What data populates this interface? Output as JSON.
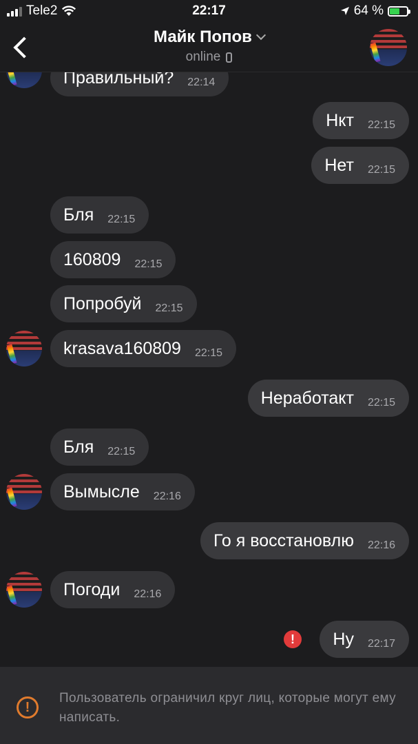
{
  "status_bar": {
    "carrier": "Tele2",
    "time": "22:17",
    "battery": "64 %",
    "battery_level": 0.64,
    "icons": [
      "signal-icon",
      "wifi-icon",
      "location-arrow-icon",
      "battery-icon"
    ]
  },
  "header": {
    "contact_name": "Майк Попов",
    "status": "online"
  },
  "messages": [
    {
      "direction": "in",
      "text": "Правильный?",
      "time": "22:14",
      "avatar": true
    },
    {
      "direction": "out",
      "text": "Нкт",
      "time": "22:15"
    },
    {
      "direction": "out",
      "text": "Нет",
      "time": "22:15"
    },
    {
      "direction": "in",
      "text": "Бля",
      "time": "22:15"
    },
    {
      "direction": "in",
      "text": "160809",
      "time": "22:15"
    },
    {
      "direction": "in",
      "text": "Попробуй",
      "time": "22:15"
    },
    {
      "direction": "in",
      "text": "krasava160809",
      "time": "22:15",
      "avatar": true
    },
    {
      "direction": "out",
      "text": "Неработакт",
      "time": "22:15"
    },
    {
      "direction": "in",
      "text": "Бля",
      "time": "22:15"
    },
    {
      "direction": "in",
      "text": "Вымысле",
      "time": "22:16",
      "avatar": true
    },
    {
      "direction": "out",
      "text": "Го я восстановлю",
      "time": "22:16"
    },
    {
      "direction": "in",
      "text": "Погоди",
      "time": "22:16",
      "avatar": true
    },
    {
      "direction": "out",
      "text": "Ну",
      "time": "22:17",
      "error": true
    }
  ],
  "footer": {
    "notice": "Пользователь ограничил круг лиц, которые могут ему написать."
  },
  "colors": {
    "background": "#1c1c1e",
    "bubble": "#333336",
    "error": "#e23b3b",
    "warning": "#e07b2d",
    "battery_fill": "#37d34f"
  }
}
